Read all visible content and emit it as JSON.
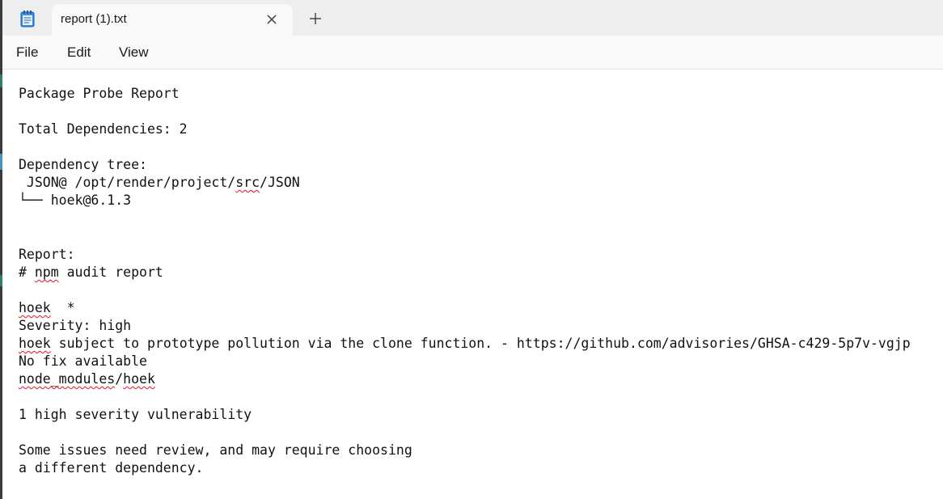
{
  "window": {
    "tab_title": "report (1).txt",
    "icons": {
      "app": "notepad-icon",
      "close": "close-icon",
      "new_tab": "plus-icon"
    }
  },
  "menu": {
    "file": "File",
    "edit": "Edit",
    "view": "View"
  },
  "document": {
    "l1": "Package Probe Report",
    "l2": "Total Dependencies: 2",
    "l3": "Dependency tree:",
    "l4a": " JSON@ /opt/render/project/",
    "l4b": "src",
    "l4c": "/JSON",
    "l5": "└── hoek@6.1.3",
    "l6": "Report:",
    "l7a": "# ",
    "l7b": "npm",
    "l7c": " audit report",
    "l8a": "hoek",
    "l8b": "  *",
    "l9": "Severity: high",
    "l10a": "hoek",
    "l10b": " subject to prototype pollution via the clone function. - https://github.com/advisories/GHSA-c429-5p7v-vgjp",
    "l11": "No fix available",
    "l12a": "node_modules",
    "l12b": "/",
    "l12c": "hoek",
    "l13": "1 high severity vulnerability",
    "l14": "Some issues need review, and may require choosing",
    "l15": "a different dependency."
  },
  "colors": {
    "titlebar": "#eeeeee",
    "tab": "#f9f9f9",
    "menubar": "#f9f9f9",
    "spell_error": "#e81123"
  }
}
